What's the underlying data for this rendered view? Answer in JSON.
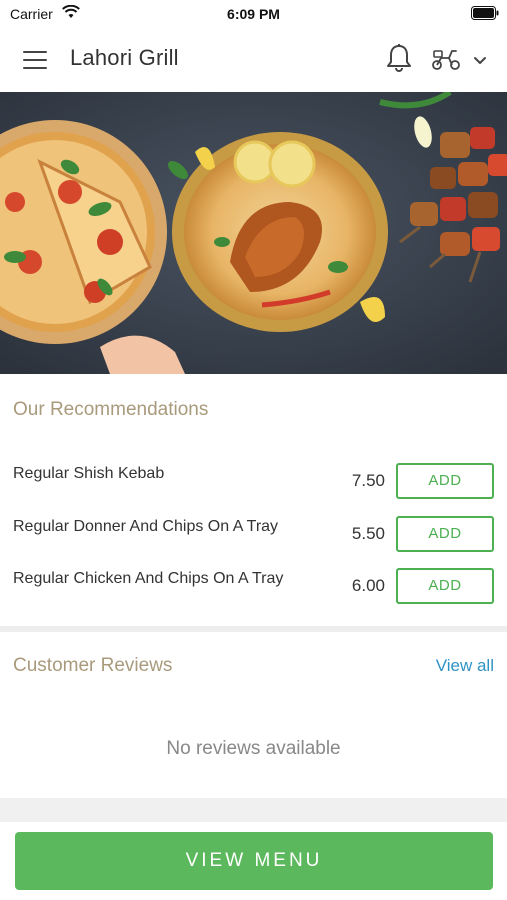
{
  "status_bar": {
    "carrier": "Carrier",
    "time": "6:09 PM",
    "wifi_icon": "wifi-icon",
    "battery_icon": "battery-icon"
  },
  "header": {
    "title": "Lahori Grill",
    "menu_icon": "hamburger-menu-icon",
    "bell_icon": "bell-icon",
    "scooter_icon": "scooter-icon",
    "chevron_icon": "chevron-down-icon"
  },
  "hero": {
    "image": "food-banner-pizza-biryani-kebab"
  },
  "recommendations": {
    "title": "Our Recommendations",
    "items": [
      {
        "name": "Regular Shish Kebab",
        "price": "7.50",
        "action": "ADD"
      },
      {
        "name": "Regular Donner And Chips On A Tray",
        "price": "5.50",
        "action": "ADD"
      },
      {
        "name": "Regular Chicken And Chips On A Tray",
        "price": "6.00",
        "action": "ADD"
      }
    ]
  },
  "reviews": {
    "title": "Customer Reviews",
    "view_all": "View all",
    "empty_text": "No reviews available"
  },
  "footer": {
    "view_menu": "VIEW MENU"
  },
  "colors": {
    "accent_green": "#5cb85c",
    "add_green": "#4caf50",
    "section_title": "#a99a7c",
    "link_blue": "#2e93c5"
  }
}
